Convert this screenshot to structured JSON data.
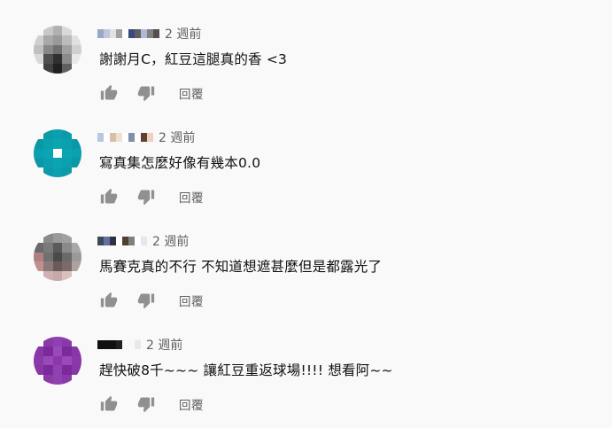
{
  "colors": {
    "background": "#f9f9f9",
    "text": "#030303",
    "secondary_text": "#606060",
    "icon": "#909090"
  },
  "comments": [
    {
      "time": "2 週前",
      "text": "謝謝月C，紅豆這腿真的香 <3",
      "reply_label": "回覆",
      "avatar_colors": [
        "#f9f9f9",
        "#c8c8c8",
        "#b0b0b0",
        "#d8d8d8",
        "#f9f9f9",
        "#d0d0d0",
        "#a8a8a8",
        "#9a9a9a",
        "#bcbcbc",
        "#e0e0e0",
        "#c0c0c0",
        "#888888",
        "#707070",
        "#a0a0a0",
        "#d0d0d0",
        "#d8d8d8",
        "#505050",
        "#303030",
        "#8a8a8a",
        "#e8e8e8",
        "#f9f9f9",
        "#404040",
        "#202020",
        "#606060",
        "#f9f9f9"
      ],
      "author_blocks": [
        "#9aa8c8",
        "#c0c8d8",
        "#e0e0e8",
        "#a0a0a0",
        "#ffffff",
        "#3a4a7a",
        "#606060",
        "#b0b8d8",
        "#808080",
        "#505050"
      ]
    },
    {
      "time": "2 週前",
      "text": "寫真集怎麼好像有幾本0.0",
      "reply_label": "回覆",
      "avatar_colors": [
        "#f9f9f9",
        "#0a9aa8",
        "#0aa0b0",
        "#0a9aa8",
        "#f9f9f9",
        "#0a98a6",
        "#0aa0ae",
        "#0aa4b2",
        "#0aa0ae",
        "#0a98a6",
        "#0aa0ae",
        "#0aa4b2",
        "#ffffff",
        "#0aa4b2",
        "#0aa0ae",
        "#0a98a6",
        "#0aa0ae",
        "#0aa4b2",
        "#0aa0ae",
        "#0a98a6",
        "#f9f9f9",
        "#0a9aa8",
        "#0aa0b0",
        "#0a9aa8",
        "#f9f9f9"
      ],
      "author_blocks": [
        "#b8c8e0",
        "#ffffff",
        "#d8c0a8",
        "#f0e0d0",
        "#ffffff",
        "#8090a8",
        "#ffffff",
        "#604030",
        "#f0d0c0"
      ]
    },
    {
      "time": "2 週前",
      "text": "馬賽克真的不行 不知道想遮甚麼但是都露光了",
      "reply_label": "回覆",
      "avatar_colors": [
        "#f9f9f9",
        "#8a8a8a",
        "#9a9a9a",
        "#a0a0a0",
        "#f9f9f9",
        "#6a6a6a",
        "#7a7a7a",
        "#5a5a5a",
        "#8a8a8a",
        "#a8a8a8",
        "#b08080",
        "#707070",
        "#4a4a4a",
        "#6a6a6a",
        "#9a9a9a",
        "#c09090",
        "#8a7a7a",
        "#6a5a5a",
        "#7a6a6a",
        "#b0a0a0",
        "#f9f9f9",
        "#d0b0b0",
        "#c8a8a8",
        "#d8c0c0",
        "#f9f9f9"
      ],
      "author_blocks": [
        "#404858",
        "#6070a0",
        "#303040",
        "#ffffff",
        "#504030",
        "#808080",
        "#ffffff",
        "#e0e8f0"
      ]
    },
    {
      "time": "2 週前",
      "text": "趕快破8千~~~  讓紅豆重返球場!!!!   想看阿~~",
      "reply_label": "回覆",
      "avatar_colors": [
        "#f9f9f9",
        "#8a3aa8",
        "#9040b0",
        "#8a3aa8",
        "#f9f9f9",
        "#8838a6",
        "#7a2a9a",
        "#9a4ab8",
        "#7a2a9a",
        "#8838a6",
        "#8a3aa8",
        "#9a4ab8",
        "#8a3aa8",
        "#9a4ab8",
        "#8a3aa8",
        "#8838a6",
        "#7a2a9a",
        "#9040b0",
        "#7a2a9a",
        "#8838a6",
        "#f9f9f9",
        "#8a3aa8",
        "#9040b0",
        "#8a3aa8",
        "#f9f9f9"
      ],
      "author_blocks": [
        "#101010",
        "#101010",
        "#101010",
        "#202020",
        "#f9f9f9",
        "#f9f9f9",
        "#e8e8e8"
      ]
    }
  ]
}
